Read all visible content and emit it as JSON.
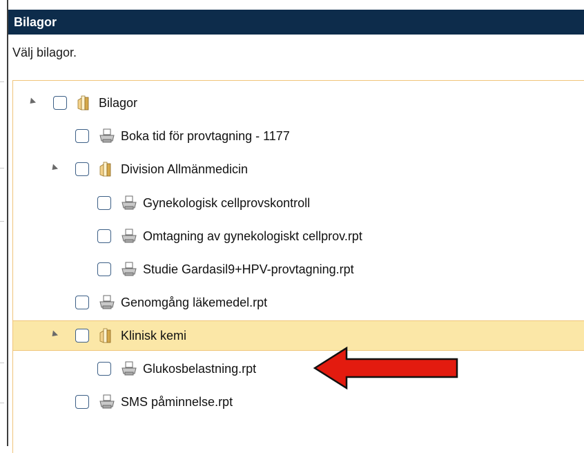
{
  "dialog": {
    "title": "Bilagor",
    "instruction": "Välj bilagor."
  },
  "tree": {
    "nodes": [
      {
        "label": "Bilagor",
        "type": "folder"
      },
      {
        "label": "Boka tid för provtagning - 1177",
        "type": "report"
      },
      {
        "label": "Division Allmänmedicin",
        "type": "folder"
      },
      {
        "label": "Gynekologisk cellprovskontroll",
        "type": "report"
      },
      {
        "label": "Omtagning av gynekologiskt cellprov.rpt",
        "type": "report"
      },
      {
        "label": "Studie Gardasil9+HPV-provtagning.rpt",
        "type": "report"
      },
      {
        "label": "Genomgång läkemedel.rpt",
        "type": "report"
      },
      {
        "label": "Klinisk kemi",
        "type": "folder",
        "selected": true
      },
      {
        "label": "Glukosbelastning.rpt",
        "type": "report"
      },
      {
        "label": "SMS påminnelse.rpt",
        "type": "report"
      }
    ]
  },
  "colors": {
    "titlebar": "#0d2c4b",
    "selection": "#fbe7a7",
    "arrow": "#e31b0f"
  },
  "icons": {
    "folder": "folder-icon",
    "report": "printer-icon",
    "expander": "expand-triangle-icon"
  }
}
